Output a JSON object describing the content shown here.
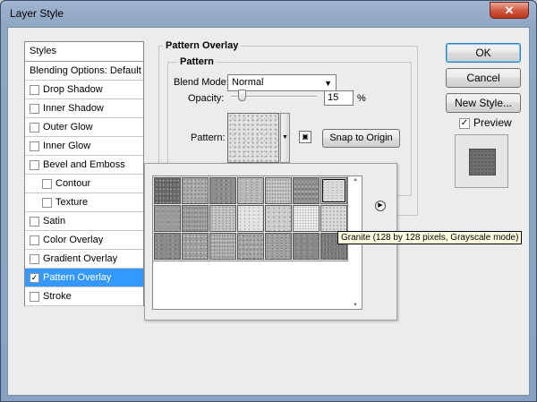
{
  "window": {
    "title": "Layer Style",
    "close_glyph": "✕"
  },
  "styles_panel": {
    "header": "Styles",
    "items": [
      {
        "label": "Blending Options: Default",
        "checkbox": false,
        "checked": false,
        "indent": false,
        "selected": false
      },
      {
        "label": "Drop Shadow",
        "checkbox": true,
        "checked": false,
        "indent": false,
        "selected": false
      },
      {
        "label": "Inner Shadow",
        "checkbox": true,
        "checked": false,
        "indent": false,
        "selected": false
      },
      {
        "label": "Outer Glow",
        "checkbox": true,
        "checked": false,
        "indent": false,
        "selected": false
      },
      {
        "label": "Inner Glow",
        "checkbox": true,
        "checked": false,
        "indent": false,
        "selected": false
      },
      {
        "label": "Bevel and Emboss",
        "checkbox": true,
        "checked": false,
        "indent": false,
        "selected": false
      },
      {
        "label": "Contour",
        "checkbox": true,
        "checked": false,
        "indent": true,
        "selected": false
      },
      {
        "label": "Texture",
        "checkbox": true,
        "checked": false,
        "indent": true,
        "selected": false
      },
      {
        "label": "Satin",
        "checkbox": true,
        "checked": false,
        "indent": false,
        "selected": false
      },
      {
        "label": "Color Overlay",
        "checkbox": true,
        "checked": false,
        "indent": false,
        "selected": false
      },
      {
        "label": "Gradient Overlay",
        "checkbox": true,
        "checked": false,
        "indent": false,
        "selected": false
      },
      {
        "label": "Pattern Overlay",
        "checkbox": true,
        "checked": true,
        "indent": false,
        "selected": true
      },
      {
        "label": "Stroke",
        "checkbox": true,
        "checked": false,
        "indent": false,
        "selected": false
      }
    ]
  },
  "pattern_overlay": {
    "section_title": "Pattern Overlay",
    "group_title": "Pattern",
    "blend_mode_label": "Blend Mode:",
    "blend_mode_value": "Normal",
    "opacity_label": "Opacity:",
    "opacity_value": "15",
    "opacity_unit": "%",
    "opacity_fraction": 0.15,
    "pattern_label": "Pattern:",
    "snap_button": "Snap to Origin"
  },
  "pattern_picker": {
    "selected_index": 6,
    "tooltip": "Granite (128 by 128 pixels, Grayscale mode)",
    "swatches": [
      "#6e6e6e",
      "#a9a9a9",
      "#8d8d8d",
      "#b8b8b8",
      "#c7c7c7",
      "#8f8f8f",
      "#dadada",
      "#9a9a9a",
      "#a3a3a3",
      "#c2c2c2",
      "#e3e3e3",
      "#cbcbcb",
      "#efefef",
      "#d9d9d9",
      "#8c8c8c",
      "#9e9e9e",
      "#b3b3b3",
      "#a7a7a7",
      "#a1a1a1",
      "#8a8a8a",
      "#7f7f7f"
    ]
  },
  "actions": {
    "ok": "OK",
    "cancel": "Cancel",
    "new_style": "New Style..."
  },
  "preview": {
    "label": "Preview",
    "checked": true
  }
}
